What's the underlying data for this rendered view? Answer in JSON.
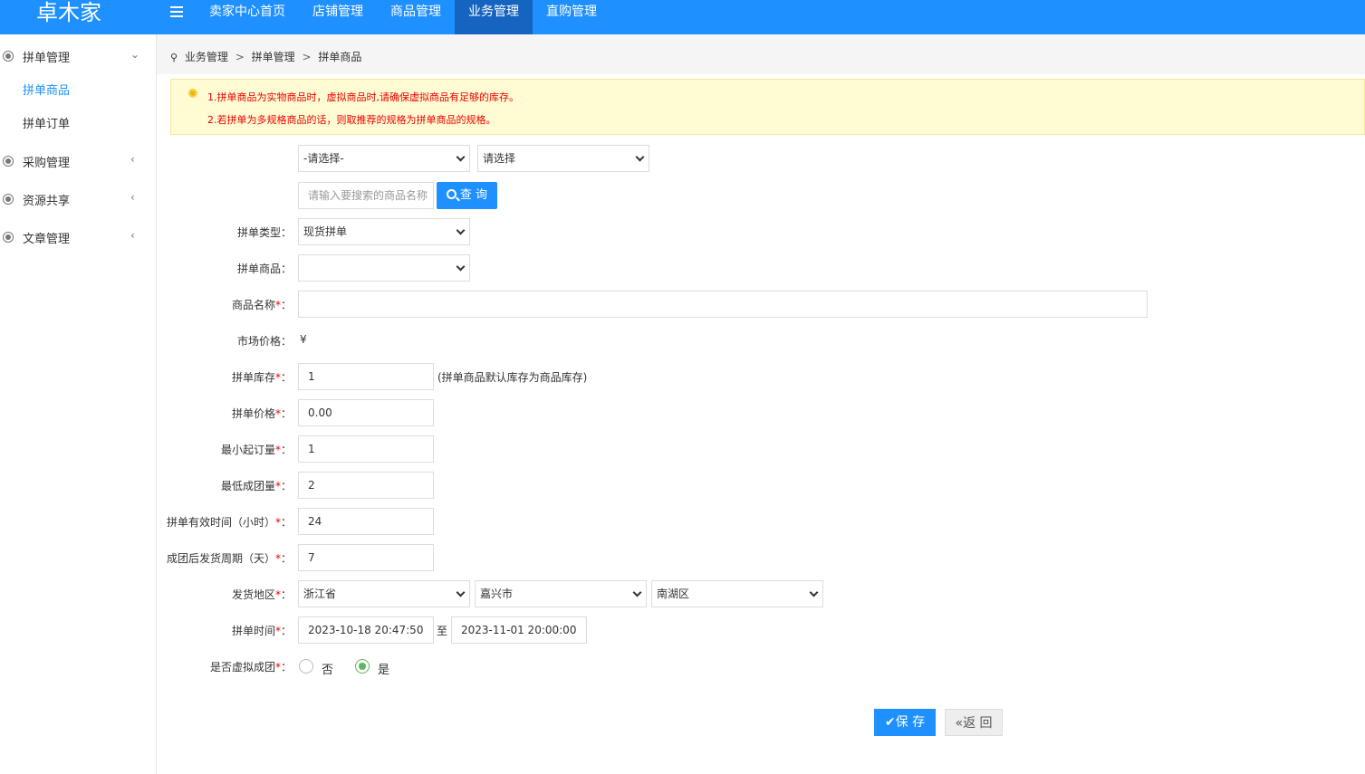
{
  "app": {
    "logo": "卓木家"
  },
  "topnav": [
    {
      "label": "卖家中心首页",
      "active": false
    },
    {
      "label": "店铺管理",
      "active": false
    },
    {
      "label": "商品管理",
      "active": false
    },
    {
      "label": "业务管理",
      "active": true
    },
    {
      "label": "直购管理",
      "active": false
    }
  ],
  "sidebar": {
    "groups": [
      {
        "label": "拼单管理",
        "arrow": "⌄",
        "expanded": true
      },
      {
        "label": "采购管理",
        "arrow": "‹"
      },
      {
        "label": "资源共享",
        "arrow": "‹"
      },
      {
        "label": "文章管理",
        "arrow": "‹"
      }
    ],
    "subitems": [
      {
        "label": "拼单商品",
        "active": true
      },
      {
        "label": "拼单订单",
        "active": false
      }
    ]
  },
  "breadcrumb": {
    "items": [
      "业务管理",
      "拼单管理",
      "拼单商品"
    ],
    "separator": ">"
  },
  "notice": {
    "lines": [
      "1.拼单商品为实物商品时，虚拟商品时,请确保虚拟商品有足够的库存。",
      "2.若拼单为多规格商品的话，则取推荐的规格为拼单商品的规格。"
    ]
  },
  "filter": {
    "category1": "-请选择-",
    "category2": "请选择",
    "search_placeholder": "请输入要搜索的商品名称",
    "query_label": "查 询"
  },
  "form": {
    "type_label": "拼单类型：",
    "type_value": "现货拼单",
    "goods_label": "拼单商品：",
    "goods_value": "",
    "name_label": "商品名称",
    "name_value": "",
    "market_price_label": "市场价格：",
    "market_price_value": "¥",
    "stock_label": "拼单库存",
    "stock_value": "1",
    "stock_hint": "(拼单商品默认库存为商品库存)",
    "price_label": "拼单价格",
    "price_value": "0.00",
    "min_order_label": "最小起订量",
    "min_order_value": "1",
    "min_group_label": "最低成团量",
    "min_group_value": "2",
    "valid_hours_label": "拼单有效时间（小时）",
    "valid_hours_value": "24",
    "ship_days_label": "成团后发货周期（天）",
    "ship_days_value": "7",
    "region_label": "发货地区",
    "province": "浙江省",
    "city": "嘉兴市",
    "district": "南湖区",
    "time_label": "拼单时间",
    "start_time": "2023-10-18 20:47:50",
    "to_label": "至",
    "end_time": "2023-11-01 20:00:00",
    "virtual_label": "是否虚拟成团",
    "option_no": "否",
    "option_yes": "是",
    "virtual_selected": "是",
    "colon": "："
  },
  "actions": {
    "save": "保 存",
    "back": "返 回"
  },
  "colors": {
    "accent": "#1e90ff",
    "nav_active": "#1565c0",
    "required": "#e00000",
    "notice_bg": "#fffbd2",
    "radio_on": "#5cb85c"
  }
}
